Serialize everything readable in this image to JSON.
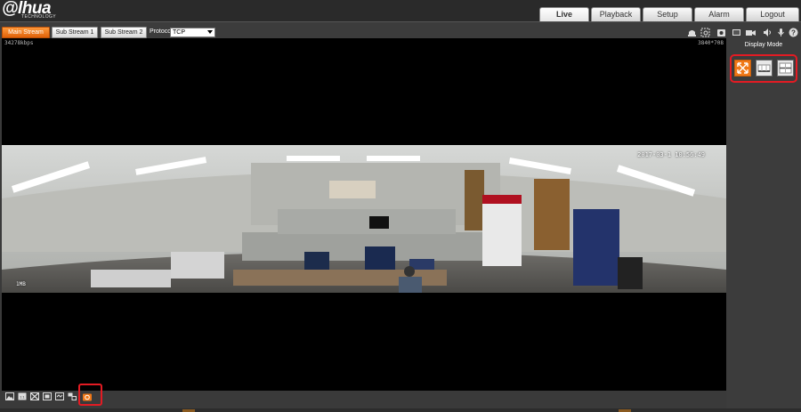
{
  "header": {
    "logo_text": "a hua",
    "logo_subtext": "TECHNOLOGY",
    "nav_tabs": [
      {
        "label": "Live",
        "active": true
      },
      {
        "label": "Playback",
        "active": false
      },
      {
        "label": "Setup",
        "active": false
      },
      {
        "label": "Alarm",
        "active": false
      },
      {
        "label": "Logout",
        "active": false
      }
    ]
  },
  "toolbar": {
    "streams": [
      {
        "label": "Main Stream",
        "active": true
      },
      {
        "label": "Sub Stream 1",
        "active": false
      },
      {
        "label": "Sub Stream 2",
        "active": false
      }
    ],
    "protocol_label": "Protocol",
    "protocol_value": "TCP",
    "icons": [
      "alarm-output-icon",
      "digital-zoom-icon",
      "snapshot-icon",
      "triple-snapshot-icon",
      "record-icon",
      "audio-icon",
      "talk-icon",
      "help-icon"
    ]
  },
  "video": {
    "bitrate": "34278kbps",
    "resolution": "3840*708",
    "osd_time": "2017-03-1 10:56:49",
    "osd_channel": "1MB"
  },
  "bottom_bar": {
    "icons": [
      "image-adjust-icon",
      "original-size-icon",
      "fullscreen-icon",
      "width-height-ratio-icon",
      "fluency-icon",
      "rules-info-icon",
      "fisheye-icon"
    ]
  },
  "side_panel": {
    "title": "Display Mode",
    "modes": [
      {
        "name": "original-mode",
        "active": true
      },
      {
        "name": "panorama-mode",
        "active": false
      },
      {
        "name": "double-panorama-mode",
        "active": false
      }
    ]
  },
  "colors": {
    "accent": "#f07818",
    "highlight_red": "#e31b23",
    "background": "#3a3a3a"
  }
}
